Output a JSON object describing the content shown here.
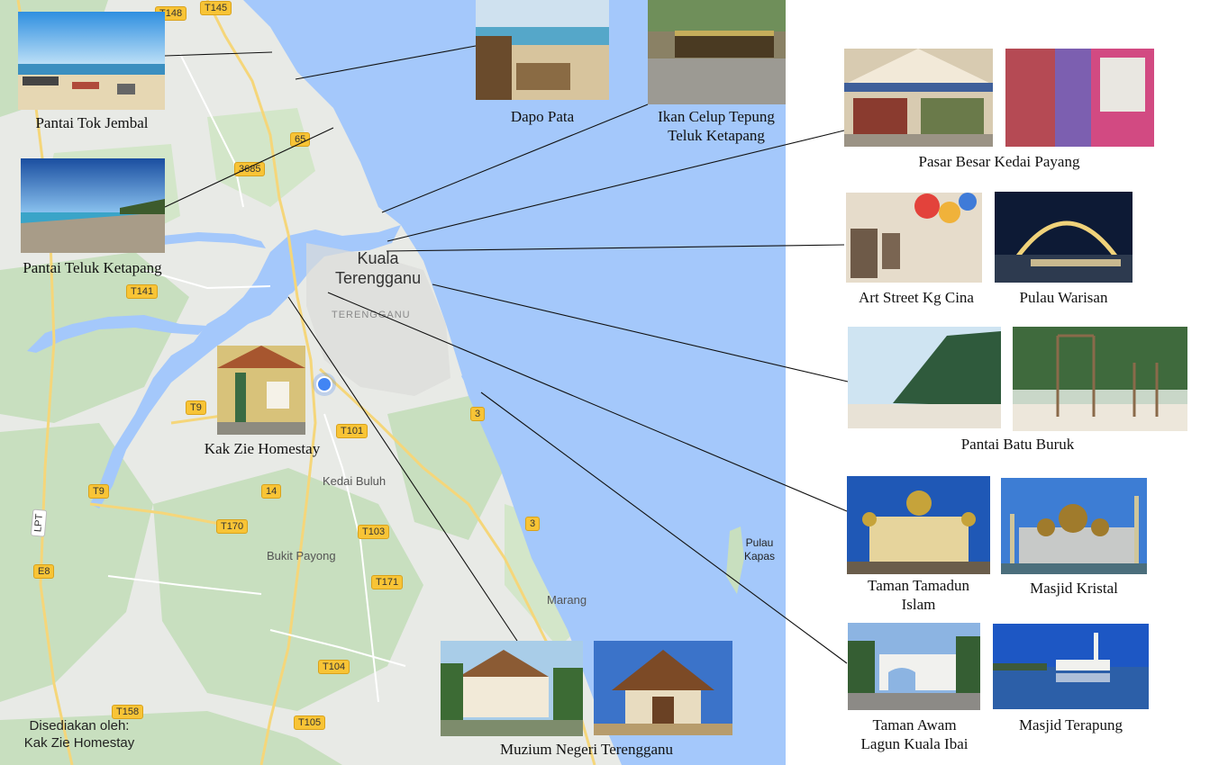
{
  "map": {
    "city": "Kuala\nTerengganu",
    "state": "TERENGGANU",
    "towns": [
      "Kedai Buluh",
      "Bukit Payong",
      "Marang"
    ],
    "island": "Pulau\nKapas",
    "roads": [
      "T148",
      "T145",
      "65",
      "3685",
      "T141",
      "T9",
      "T101",
      "3",
      "T9",
      "14",
      "T170",
      "T103",
      "3",
      "E8",
      "T171",
      "T104",
      "T158",
      "T105",
      "LPT"
    ],
    "water_color": "#a4c8fb",
    "land_color": "#e8eae6",
    "park_color": "#c8dfbf"
  },
  "credit": "Disediakan oleh:\nKak Zie Homestay",
  "places": {
    "tok_jembal": "Pantai Tok Jembal",
    "teluk_ketapang": "Pantai Teluk Ketapang",
    "dapo_pata": "Dapo Pata",
    "ikan_celup": "Ikan Celup Tepung\nTeluk Ketapang",
    "pasar_payang": "Pasar Besar Kedai Payang",
    "art_street": "Art Street Kg Cina",
    "pulau_warisan": "Pulau Warisan",
    "batu_buruk": "Pantai Batu Buruk",
    "tamadun": "Taman Tamadun\nIslam",
    "kristal": "Masjid Kristal",
    "ibai": "Taman Awam\nLagun Kuala Ibai",
    "terapung": "Masjid Terapung",
    "homestay": "Kak Zie Homestay",
    "muzium": "Muzium Negeri Terengganu"
  }
}
